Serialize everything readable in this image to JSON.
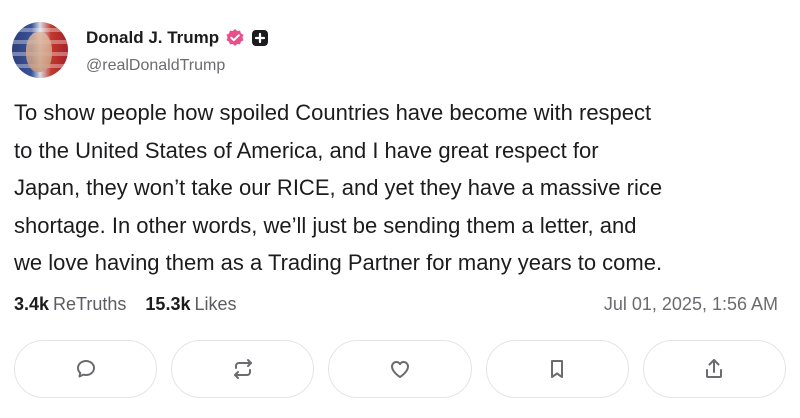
{
  "author": {
    "display_name": "Donald J. Trump",
    "handle": "@realDonaldTrump",
    "verified_icon": "verified-badge-icon",
    "verified_color": "#e9508b",
    "badge_icon": "plus-square-icon"
  },
  "post": {
    "text": "To show people how spoiled Countries have become with respect\nto the United States of America, and I have great respect for\nJapan, they won’t take our RICE, and yet they have a massive rice\nshortage. In other words, we’ll just be sending them a letter, and\nwe love having them as a Trading Partner for many years to come."
  },
  "stats": {
    "retruths_count": "3.4k",
    "retruths_label": "ReTruths",
    "likes_count": "15.3k",
    "likes_label": "Likes",
    "timestamp": "Jul 01, 2025, 1:56 AM"
  },
  "actions": [
    {
      "name": "reply",
      "icon": "comment-icon"
    },
    {
      "name": "retruth",
      "icon": "repost-icon"
    },
    {
      "name": "like",
      "icon": "heart-icon"
    },
    {
      "name": "bookmark",
      "icon": "bookmark-icon"
    },
    {
      "name": "share",
      "icon": "share-icon"
    }
  ],
  "colors": {
    "text": "#1c1c1e",
    "muted": "#6b6b70",
    "border": "#e4e4e8",
    "icon": "#6b6b70"
  }
}
